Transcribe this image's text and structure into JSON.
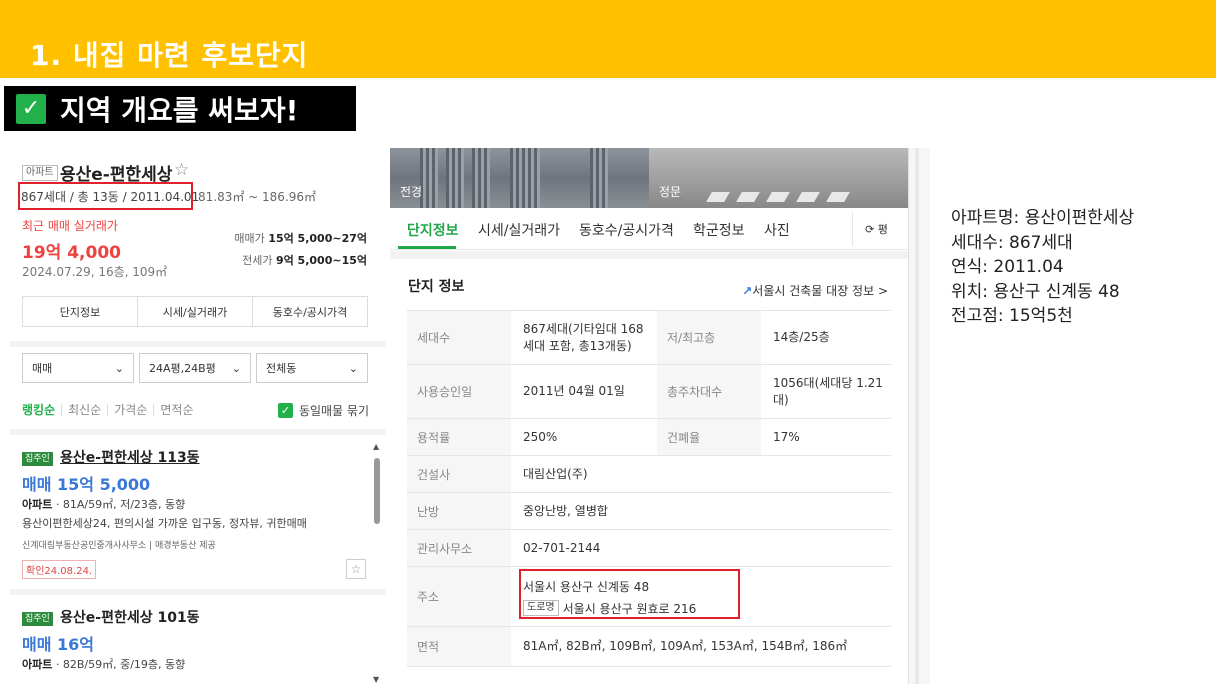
{
  "banner": {
    "title": "1. 내집 마련 후보단지"
  },
  "subhead": {
    "check": "✓",
    "text": "지역 개요를 써보자!"
  },
  "left": {
    "tag": "아파트",
    "name": "용산e-편한세상",
    "star": "☆",
    "meta": "867세대 / 총 13동 / 2011.04.01",
    "area": "81.83㎡ ~ 186.96㎡",
    "recent_label": "최근 매매 실거래가",
    "recent_price": "19억 4,000",
    "recent_date": "2024.07.29, 16층, 109㎡",
    "sale_label": "매매가",
    "sale_value": "15억 5,000~27억",
    "rent_label": "전세가",
    "rent_value": "9억 5,000~15억",
    "tabs": [
      "단지정보",
      "시세/실거래가",
      "동호수/공시가격"
    ],
    "filters": [
      "매매",
      "24A평,24B평",
      "전체동"
    ],
    "sort": [
      "랭킹순",
      "최신순",
      "가격순",
      "면적순"
    ],
    "same_listing": "동일매물 묶기",
    "listings": [
      {
        "badge": "집주인",
        "title": "용산e-편한세상 113동",
        "price": "매매 15억 5,000",
        "type": "아파트",
        "desc": " · 81A/59㎡, 저/23층, 동향",
        "desc2": "용산이편한세상24, 편의시설 가까운 입구동, 정자뷰, 귀한매매",
        "agent": "신계대림부동산공인중개사사무소 | 매경부동산 제공",
        "confirm": "확인24.08.24."
      },
      {
        "badge": "집주인",
        "title": "용산e-편한세상 101동",
        "price": "매매 16억",
        "type": "아파트",
        "desc": " · 82B/59㎡, 중/19층, 동향"
      }
    ]
  },
  "right": {
    "photo_labels": [
      "전경",
      "정문"
    ],
    "tabs": [
      "단지정보",
      "시세/실거래가",
      "동호수/공시가격",
      "학군정보",
      "사진"
    ],
    "refresh": "⟳ 평",
    "section_title": "단지 정보",
    "registry_link": "서울시 건축물 대장 정보 >",
    "rows": [
      {
        "label": "세대수",
        "value": "867세대(기타임대 168세대 포함, 총13개동)",
        "label2": "저/최고층",
        "value2": "14층/25층"
      },
      {
        "label": "사용승인일",
        "value": "2011년 04월 01일",
        "label2": "총주차대수",
        "value2": "1056대(세대당 1.21대)"
      },
      {
        "label": "용적률",
        "value": "250%",
        "label2": "건폐율",
        "value2": "17%"
      },
      {
        "label": "건설사",
        "value": "대림산업(주)"
      },
      {
        "label": "난방",
        "value": "중앙난방, 열병합"
      },
      {
        "label": "관리사무소",
        "value": "02-701-2144"
      },
      {
        "label": "주소",
        "addr1": "서울시 용산구 신계동 48",
        "road_tag": "도로명",
        "addr2": "서울시 용산구 원효로 216"
      },
      {
        "label": "면적",
        "value": "81A㎡, 82B㎡, 109B㎡, 109A㎡, 153A㎡, 154B㎡, 186㎡"
      }
    ]
  },
  "notes": [
    "아파트명: 용산이편한세상",
    "세대수: 867세대",
    "연식: 2011.04",
    "위치: 용산구 신계동 48",
    "전고점: 15억5천"
  ]
}
